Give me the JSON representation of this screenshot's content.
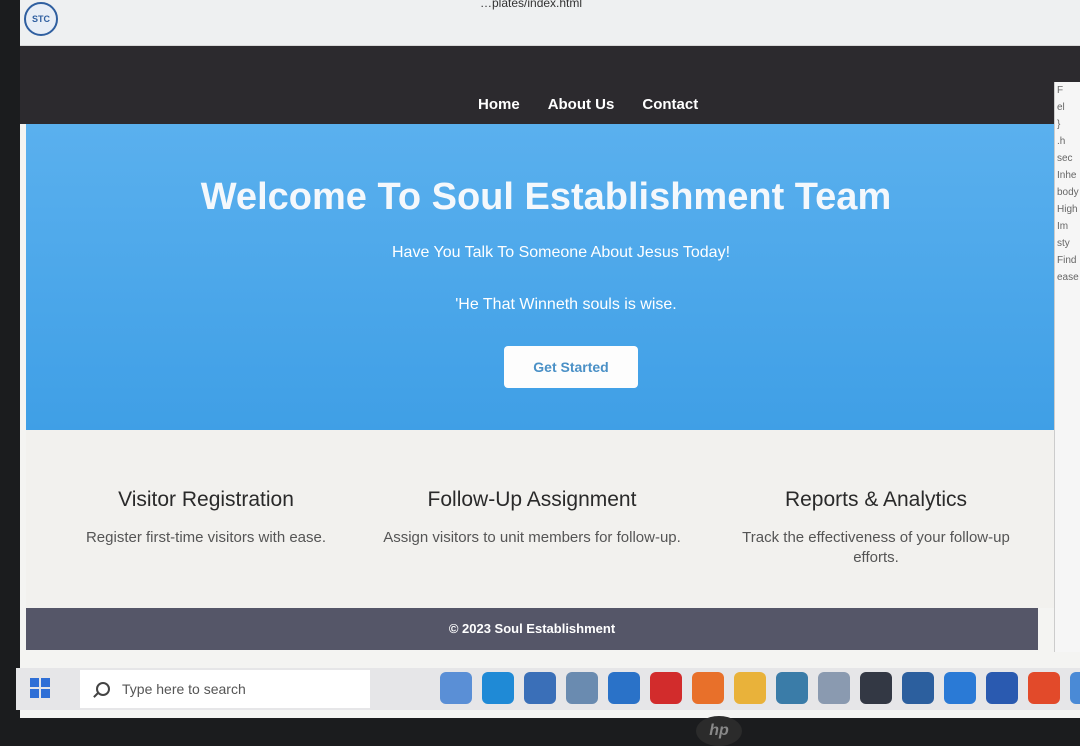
{
  "browser": {
    "address_fragment": "…plates/index.html",
    "logo_text": "STC"
  },
  "nav": {
    "items": [
      "Home",
      "About Us",
      "Contact"
    ]
  },
  "hero": {
    "title": "Welcome To Soul Establishment Team",
    "subtitle": "Have You Talk To Someone About Jesus Today!",
    "quote": "'He That Winneth souls is wise.",
    "cta_label": "Get Started"
  },
  "features": [
    {
      "title": "Visitor Registration",
      "text": "Register first-time visitors with ease."
    },
    {
      "title": "Follow-Up Assignment",
      "text": "Assign visitors to unit members for follow-up."
    },
    {
      "title": "Reports & Analytics",
      "text": "Track the effectiveness of your follow-up efforts."
    }
  ],
  "footer": {
    "text": "© 2023 Soul Establishment"
  },
  "devtools": {
    "fragments": [
      "F",
      "el",
      "}",
      ".h",
      "sec",
      "Inhe",
      "body",
      "High",
      "Im",
      "sty",
      "Find",
      "ease"
    ]
  },
  "taskbar": {
    "search_placeholder": "Type here to search",
    "apps": [
      "file-explorer-icon",
      "edge-icon",
      "store-icon",
      "files-icon",
      "mail-icon",
      "opera-icon",
      "firefox-icon",
      "chrome-icon",
      "photos-icon",
      "notepad-icon",
      "terminal-icon",
      "network-icon",
      "vscode-icon",
      "outlook-icon",
      "git-icon",
      "chrome-alt-icon"
    ],
    "app_colors": [
      "#5a8fd6",
      "#1f8ad6",
      "#3a6fb8",
      "#6a8bb0",
      "#2a72c8",
      "#d22c2c",
      "#e8702a",
      "#e9b23a",
      "#3a7ca8",
      "#8a9ab0",
      "#333844",
      "#2c5f9e",
      "#2a7ad6",
      "#2a5ab0",
      "#e24a2a",
      "#4a8ad6"
    ]
  },
  "colors": {
    "hero": "#4aa7ea",
    "navbar": "#2c2a2e",
    "footer": "#555668",
    "cta_text": "#4a90c6"
  }
}
